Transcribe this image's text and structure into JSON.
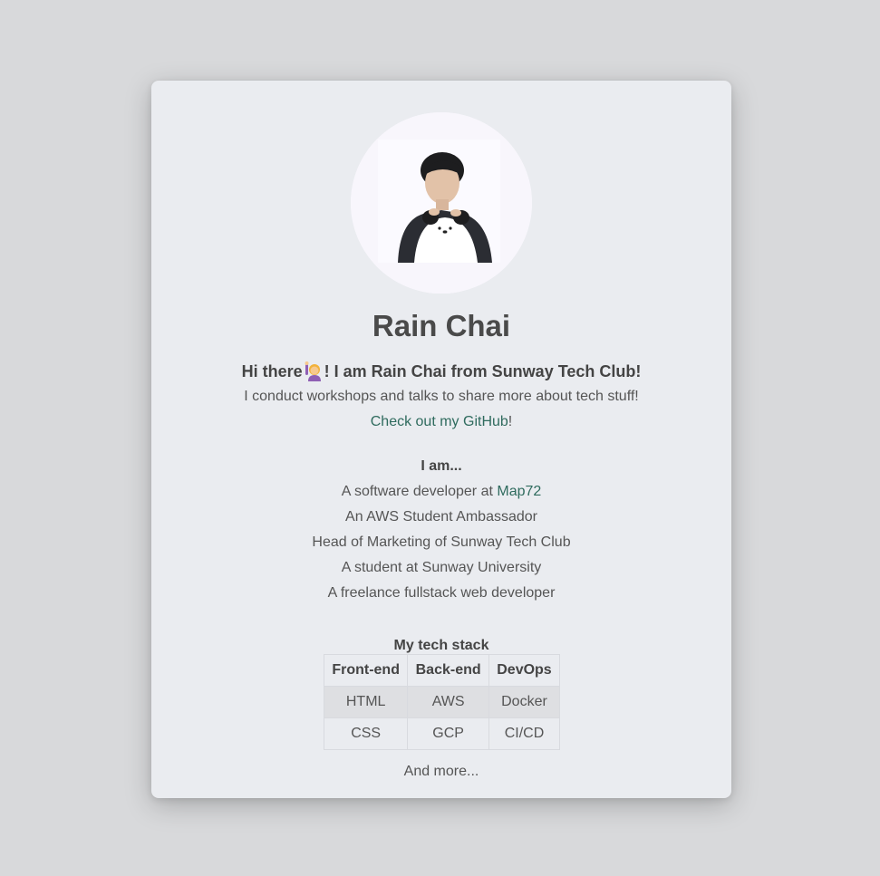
{
  "profile": {
    "name": "Rain Chai",
    "greeting_before": "Hi there",
    "greeting_emoji": "person-raising-hand-icon",
    "greeting_after": "! I am Rain Chai from Sunway Tech Club!",
    "intro": "I conduct workshops and talks to share more about tech stuff!",
    "github_link": "Check out my GitHub",
    "github_suffix": "!"
  },
  "about": {
    "heading": "I am...",
    "developer_prefix": "A software developer at ",
    "developer_link": "Map72",
    "items": [
      "An AWS Student Ambassador",
      "Head of Marketing of Sunway Tech Club",
      "A student at Sunway University",
      "A freelance fullstack web developer"
    ]
  },
  "stack": {
    "heading": "My tech stack",
    "columns": [
      "Front-end",
      "Back-end",
      "DevOps"
    ],
    "rows": [
      [
        "HTML",
        "AWS",
        "Docker"
      ],
      [
        "CSS",
        "GCP",
        "CI/CD"
      ]
    ],
    "footer": "And more..."
  },
  "colors": {
    "page_bg": "#d8d9db",
    "card_bg": "#eaecf0",
    "link": "#2f6b5e",
    "text": "#4a4a4a"
  }
}
